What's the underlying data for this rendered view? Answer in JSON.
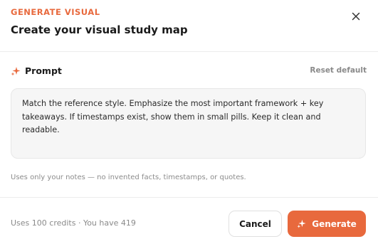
{
  "header": {
    "eyebrow": "GENERATE VISUAL",
    "title": "Create your visual study map",
    "close_icon": "close-icon"
  },
  "prompt": {
    "icon": "sparkle-icon",
    "label": "Prompt",
    "reset_label": "Reset default",
    "text": "Match the reference style. Emphasize the most important framework + key takeaways. If timestamps exist, show them in small pills. Keep it clean and readable."
  },
  "hint": "Uses only your notes — no invented facts, timestamps, or quotes.",
  "footer": {
    "credits": "Uses 100 credits · You have 419",
    "cancel_label": "Cancel",
    "generate_label": "Generate",
    "generate_icon": "sparkle-icon"
  },
  "colors": {
    "accent": "#e8693d",
    "muted_text": "#8a8a8a",
    "input_bg": "#f6f6f6"
  }
}
